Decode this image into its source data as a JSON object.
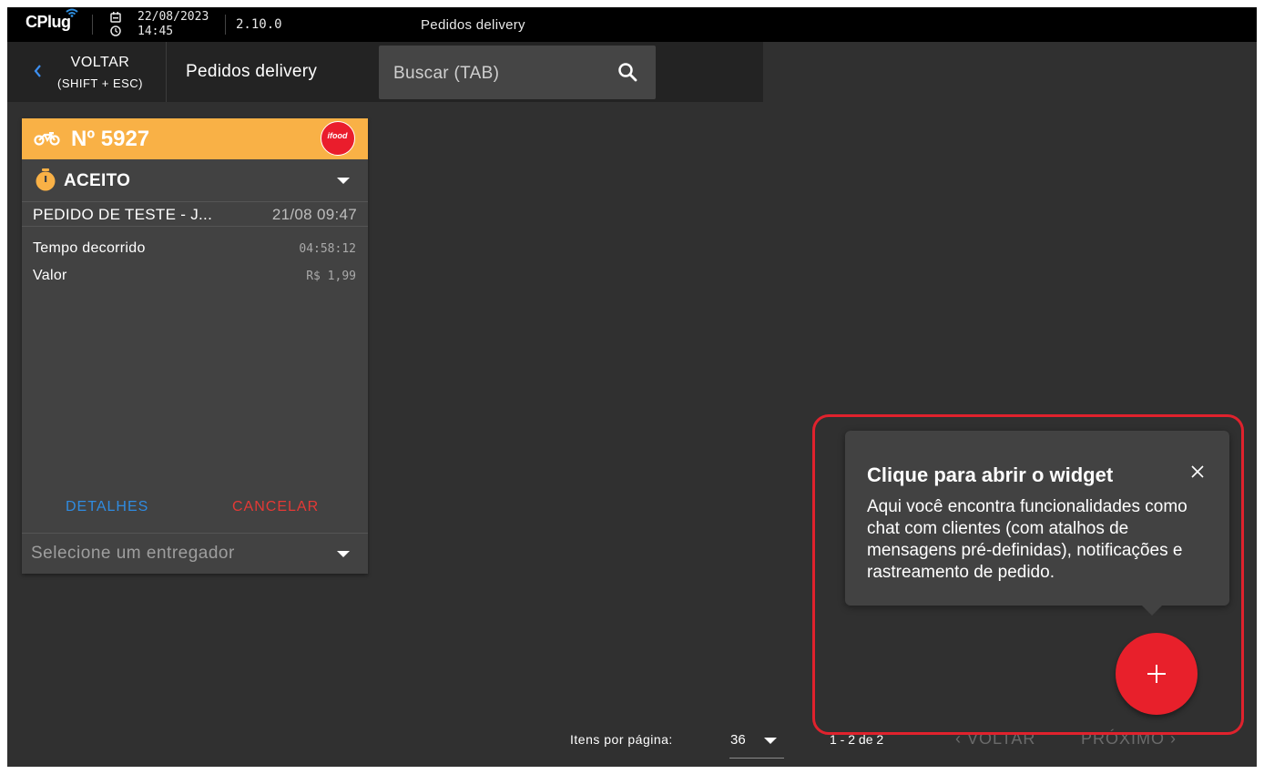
{
  "statusbar": {
    "logo": "CPlug",
    "date": "22/08/2023",
    "time": "14:45",
    "version": "2.10.0",
    "title": "Pedidos delivery"
  },
  "header": {
    "back_label": "VOLTAR",
    "back_hint": "(SHIFT + ESC)",
    "page_title": "Pedidos delivery",
    "search_placeholder": "Buscar (TAB)"
  },
  "order": {
    "number": "Nº 5927",
    "platform": "ifood",
    "status": "ACEITO",
    "customer": "PEDIDO DE TESTE - J...",
    "datetime": "21/08 09:47",
    "rows": [
      {
        "label": "Tempo decorrido",
        "value": "04:58:12"
      },
      {
        "label": "Valor",
        "value": "R$ 1,99"
      }
    ],
    "details_label": "DETALHES",
    "cancel_label": "CANCELAR",
    "courier_placeholder": "Selecione um entregador"
  },
  "pagination": {
    "per_page_label": "Itens por página:",
    "per_page_value": "36",
    "range": "1 - 2 de 2",
    "prev_label": "VOLTAR",
    "next_label": "PRÓXIMO"
  },
  "tooltip": {
    "title": "Clique para abrir o widget",
    "body": "Aqui você encontra funcionalidades como chat com clientes (com atalhos de mensagens pré-definidas), notificações e rastreamento de pedido."
  },
  "icons": {
    "wifi": "wifi-icon",
    "calendar": "calendar-icon",
    "clock": "clock-icon",
    "back": "chevron-left-icon",
    "search": "search-icon",
    "bike": "bike-icon",
    "timer": "timer-icon",
    "close": "close-icon",
    "add": "plus-icon"
  },
  "colors": {
    "accent_header": "#f9b146",
    "ifood": "#ea1d2c",
    "details": "#2f8be0",
    "cancel": "#e53935",
    "fab": "#e8202b",
    "highlight": "#e0222d"
  }
}
